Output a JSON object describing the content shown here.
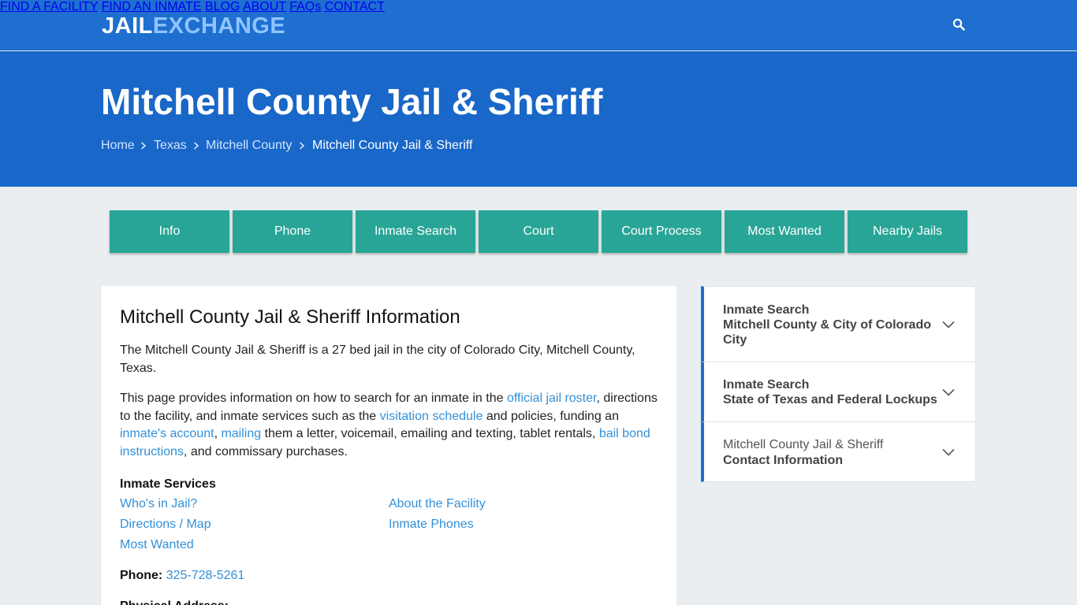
{
  "header": {
    "logo_part1": "JAIL",
    "logo_part2": "EXCHANGE",
    "nav": [
      "FIND A FACILITY",
      "FIND AN INMATE",
      "BLOG",
      "ABOUT",
      "FAQs",
      "CONTACT"
    ],
    "search_icon": "search-icon"
  },
  "hero": {
    "title": "Mitchell County Jail & Sheriff",
    "breadcrumb": [
      "Home",
      "Texas",
      "Mitchell County",
      "Mitchell County Jail & Sheriff"
    ]
  },
  "tabs": [
    "Info",
    "Phone",
    "Inmate Search",
    "Court",
    "Court Process",
    "Most Wanted",
    "Nearby Jails"
  ],
  "main": {
    "heading": "Mitchell County Jail & Sheriff Information",
    "intro": "The Mitchell County Jail & Sheriff is a 27 bed jail in the city of Colorado City, Mitchell County, Texas.",
    "p2": {
      "t1": "This page provides information on how to search for an inmate in the ",
      "l1": "official jail roster",
      "t2": ", directions to the facility, and inmate services such as the ",
      "l2": "visitation schedule",
      "t3": " and policies, funding an ",
      "l3": "inmate's account",
      "t4": ", ",
      "l4": "mailing",
      "t5": " them a letter, voicemail, emailing and texting, tablet rentals, ",
      "l5": "bail bond instructions",
      "t6": ", and commissary purchases."
    },
    "services_title": "Inmate Services",
    "services": [
      "Who's in Jail?",
      "Directions / Map",
      "Most Wanted",
      "About the Facility",
      "Inmate Phones"
    ],
    "phone_label": "Phone:",
    "phone_value": "325-728-5261",
    "address_label": "Physical Address:"
  },
  "sidebar": [
    {
      "line1": "Inmate Search",
      "line2": "Mitchell County & City of Colorado",
      "line3": "City"
    },
    {
      "line1": "Inmate Search",
      "line2": "State of Texas and Federal Lockups"
    },
    {
      "line1": "Mitchell County Jail & Sheriff",
      "line2": "Contact Information"
    }
  ],
  "colors": {
    "topbar": "#1e6fd0",
    "hero": "#1967c8",
    "tab_button": "#28a596",
    "link": "#3390d8",
    "logo_accent": "#8fc4ff"
  }
}
